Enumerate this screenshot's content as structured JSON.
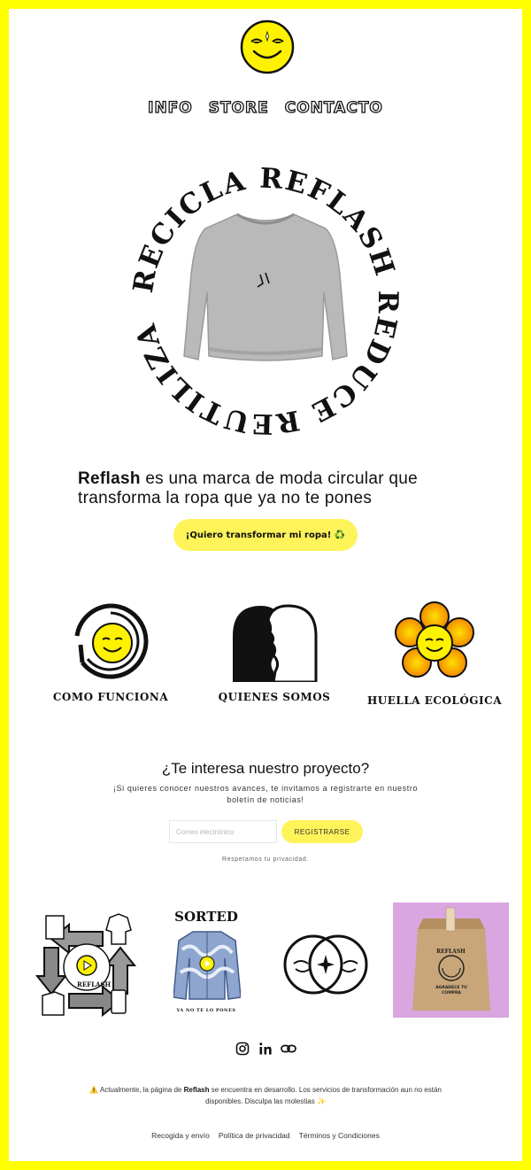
{
  "brand": {
    "name": "Reflash",
    "accent": "#ffff00",
    "button_yellow": "#fff35a"
  },
  "nav": {
    "items": [
      {
        "label": "INFO"
      },
      {
        "label": "STORE"
      },
      {
        "label": "CONTACTO"
      }
    ]
  },
  "hero": {
    "ring_words": [
      "REFLASH",
      "REDUCE",
      "REUTILIZA",
      "RECICLA"
    ],
    "image": "grey-sweatshirt"
  },
  "intro": {
    "brand": "Reflash",
    "text": " es una marca de moda circular que transforma la ropa que ya no te pones"
  },
  "cta": {
    "label": "¡Quiero transformar mi ropa! ♻️"
  },
  "features": [
    {
      "label": "COMO FUNCIONA",
      "icon": "smiley-recycle-icon"
    },
    {
      "label": "QUIENES SOMOS",
      "icon": "two-faces-icon"
    },
    {
      "label": "HUELLA ECOLÓGICA",
      "icon": "smiley-flower-icon"
    }
  ],
  "newsletter": {
    "title": "¿Te interesa nuestro proyecto?",
    "subtitle": "¡Si quieres conocer nuestros avances, te invitamos a registrarte en nuestro boletín de noticias!",
    "email_placeholder": "Correo electrónico",
    "button": "REGISTRARSE",
    "privacy": "Respetamos tu privacidad."
  },
  "gallery": {
    "g2_title": "SORTED",
    "g2_caption": "YA NO TE LO PONES",
    "g4_bag_brand": "REFLASH",
    "g4_bag_text": "AGRADECE TU COMPRA"
  },
  "social": [
    {
      "icon": "instagram-icon"
    },
    {
      "icon": "linkedin-icon"
    },
    {
      "icon": "link-icon"
    }
  ],
  "notice": {
    "icon": "⚠️",
    "before": " Actualmente, la página de ",
    "brand": "Reflash",
    "after": " se encuentra en desarrollo. Los servicios de transformación aun no están disponibles. Disculpa las molestias ",
    "end_icon": "✨"
  },
  "footer": {
    "links": [
      {
        "label": "Recogida y envío"
      },
      {
        "label": "Política de privacidad"
      },
      {
        "label": "Términos y Condiciones"
      }
    ]
  }
}
